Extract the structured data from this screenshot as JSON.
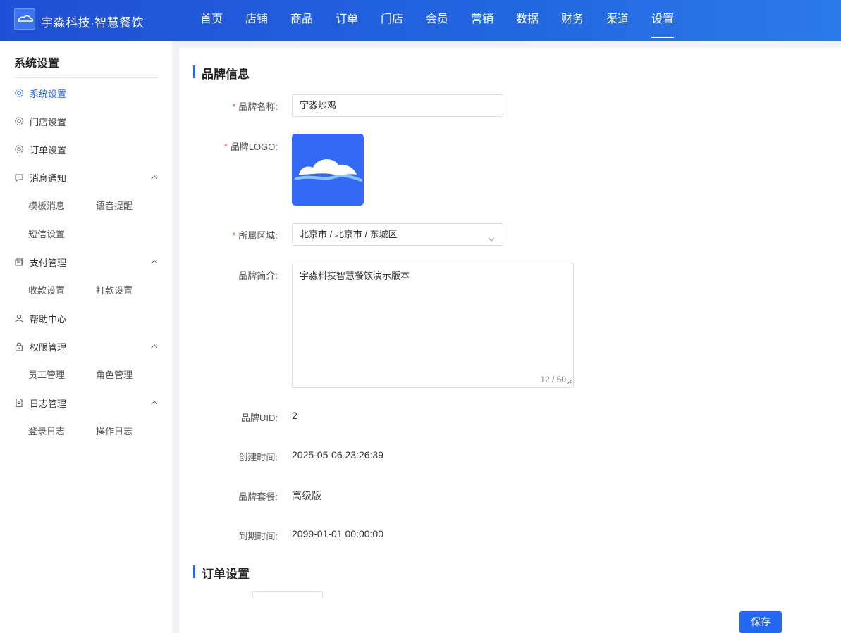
{
  "header": {
    "brand": "宇淼科技·智慧餐饮",
    "nav": [
      "首页",
      "店铺",
      "商品",
      "订单",
      "门店",
      "会员",
      "营销",
      "数据",
      "财务",
      "渠道",
      "设置"
    ],
    "active_nav": "设置"
  },
  "sidebar": {
    "title": "系统设置",
    "items": [
      {
        "label": "系统设置",
        "icon": "gear-icon",
        "active": true
      },
      {
        "label": "门店设置",
        "icon": "gear-icon"
      },
      {
        "label": "订单设置",
        "icon": "gear-icon"
      },
      {
        "label": "消息通知",
        "icon": "message-icon",
        "expanded": true,
        "children": [
          "模板消息",
          "语音提醒",
          "短信设置"
        ]
      },
      {
        "label": "支付管理",
        "icon": "wallet-icon",
        "expanded": true,
        "children": [
          "收款设置",
          "打款设置"
        ]
      },
      {
        "label": "帮助中心",
        "icon": "user-icon"
      },
      {
        "label": "权限管理",
        "icon": "lock-icon",
        "expanded": true,
        "children": [
          "员工管理",
          "角色管理"
        ]
      },
      {
        "label": "日志管理",
        "icon": "log-icon",
        "expanded": true,
        "children": [
          "登录日志",
          "操作日志"
        ]
      }
    ]
  },
  "brand_info": {
    "section_title": "品牌信息",
    "name_label": "品牌名称:",
    "name_value": "宇淼炒鸡",
    "logo_label": "品牌LOGO:",
    "region_label": "所属区域:",
    "region_value": "北京市 / 北京市 / 东城区",
    "intro_label": "品牌简介:",
    "intro_value": "宇淼科技智慧餐饮演示版本",
    "intro_counter": "12 / 50",
    "uid_label": "品牌UID:",
    "uid_value": "2",
    "created_label": "创建时间:",
    "created_value": "2025-05-06 23:26:39",
    "plan_label": "品牌套餐:",
    "plan_value": "高级版",
    "expire_label": "到期时间:",
    "expire_value": "2099-01-01 00:00:00"
  },
  "order_settings": {
    "section_title": "订单设置"
  },
  "actions": {
    "save_label": "保存"
  },
  "colors": {
    "accent": "#2468f2",
    "required": "#f04a4a",
    "header_gradient_start": "#1f4fd6",
    "header_gradient_end": "#2b7ae8"
  }
}
